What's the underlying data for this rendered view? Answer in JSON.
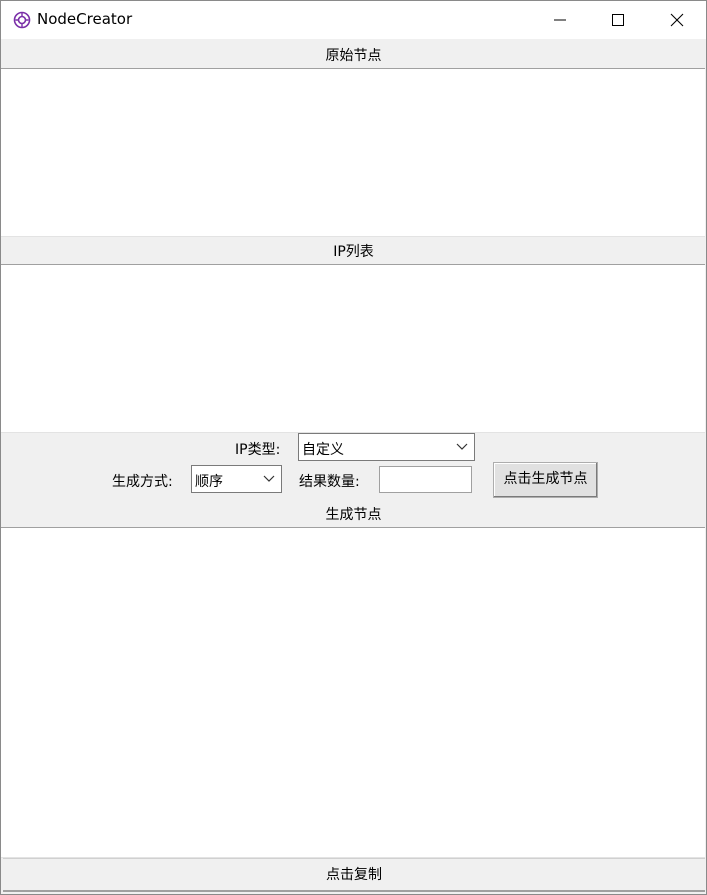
{
  "window": {
    "title": "NodeCreator",
    "icon": "openai-logo-icon",
    "controls": [
      "minimize-icon",
      "maximize-icon",
      "close-icon"
    ]
  },
  "sections": {
    "raw_nodes_label": "原始节点",
    "ip_list_label": "IP列表",
    "generated_nodes_label": "生成节点"
  },
  "form": {
    "ip_type_label": "IP类型:",
    "ip_type_value": "自定义",
    "gen_mode_label": "生成方式:",
    "gen_mode_value": "顺序",
    "result_count_label": "结果数量:",
    "result_count_value": "",
    "generate_button": "点击生成节点"
  },
  "copy_button": "点击复制"
}
